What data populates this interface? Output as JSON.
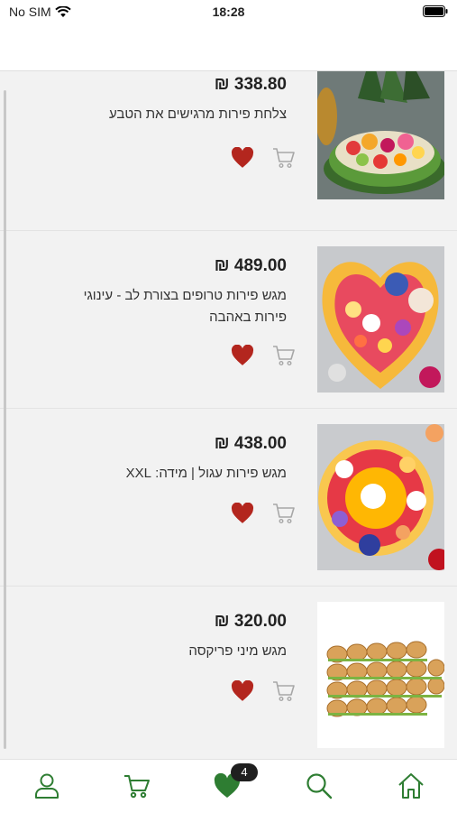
{
  "status_bar": {
    "carrier": "No SIM",
    "time": "18:28"
  },
  "products": [
    {
      "price": "338.80 ₪",
      "title": "צלחת פירות מרגישים את הטבע",
      "image": "fruit-basket-watermelon"
    },
    {
      "price": "489.00 ₪",
      "title": "מגש פירות טרופים בצורת לב - עינוגי פירות באהבה",
      "image": "heart-tropical-fruit-platter"
    },
    {
      "price": "438.00 ₪",
      "title": "מגש פירות עגול | מידה: XXL",
      "image": "round-fruit-platter"
    },
    {
      "price": "320.00 ₪",
      "title": "מגש מיני פריקסה",
      "image": "mini-sandwich-tray"
    }
  ],
  "tabbar": {
    "items": [
      "profile-icon",
      "cart-icon",
      "favorites-icon",
      "search-icon",
      "home-icon"
    ],
    "favorites_badge": "4"
  },
  "colors": {
    "accent": "#2e7d32",
    "heart": "#b3261e"
  }
}
